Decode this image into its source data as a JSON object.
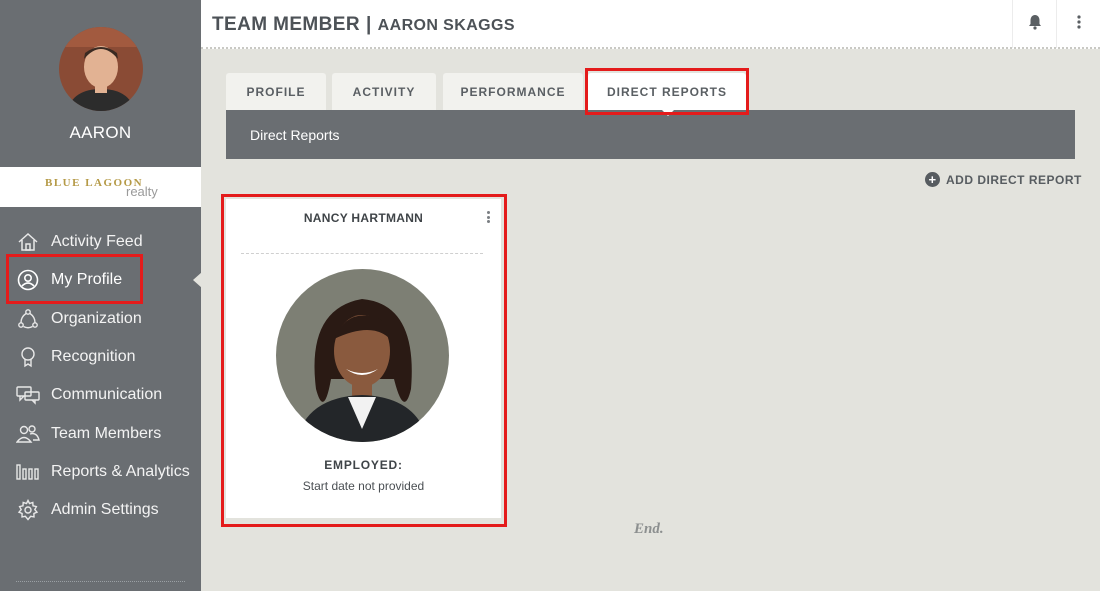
{
  "header": {
    "title": "TEAM MEMBER",
    "separator": "|",
    "member_name": "AARON SKAGGS"
  },
  "sidebar": {
    "user_name": "AARON",
    "brand": {
      "name": "BLUE LAGOON",
      "sub": "realty"
    },
    "items": [
      {
        "label": "Activity Feed",
        "icon": "home-icon"
      },
      {
        "label": "My Profile",
        "icon": "user-circle-icon",
        "active": true
      },
      {
        "label": "Organization",
        "icon": "org-icon"
      },
      {
        "label": "Recognition",
        "icon": "ribbon-icon"
      },
      {
        "label": "Communication",
        "icon": "chat-icon"
      },
      {
        "label": "Team Members",
        "icon": "people-icon"
      },
      {
        "label": "Reports & Analytics",
        "icon": "bars-icon"
      },
      {
        "label": "Admin Settings",
        "icon": "gear-icon"
      }
    ]
  },
  "tabs": [
    {
      "label": "PROFILE"
    },
    {
      "label": "ACTIVITY"
    },
    {
      "label": "PERFORMANCE"
    },
    {
      "label": "DIRECT REPORTS",
      "active": true
    }
  ],
  "section": {
    "title": "Direct Reports"
  },
  "actions": {
    "add_direct_report": "ADD DIRECT REPORT"
  },
  "direct_reports": [
    {
      "name": "NANCY HARTMANN",
      "status": "EMPLOYED:",
      "start_date": "Start date not provided"
    }
  ],
  "footer": {
    "end_text": "End."
  },
  "colors": {
    "sidebar": "#6a6e72",
    "highlight": "#e41b1b",
    "background": "#e3e3dd",
    "brand": "#b59a47"
  }
}
